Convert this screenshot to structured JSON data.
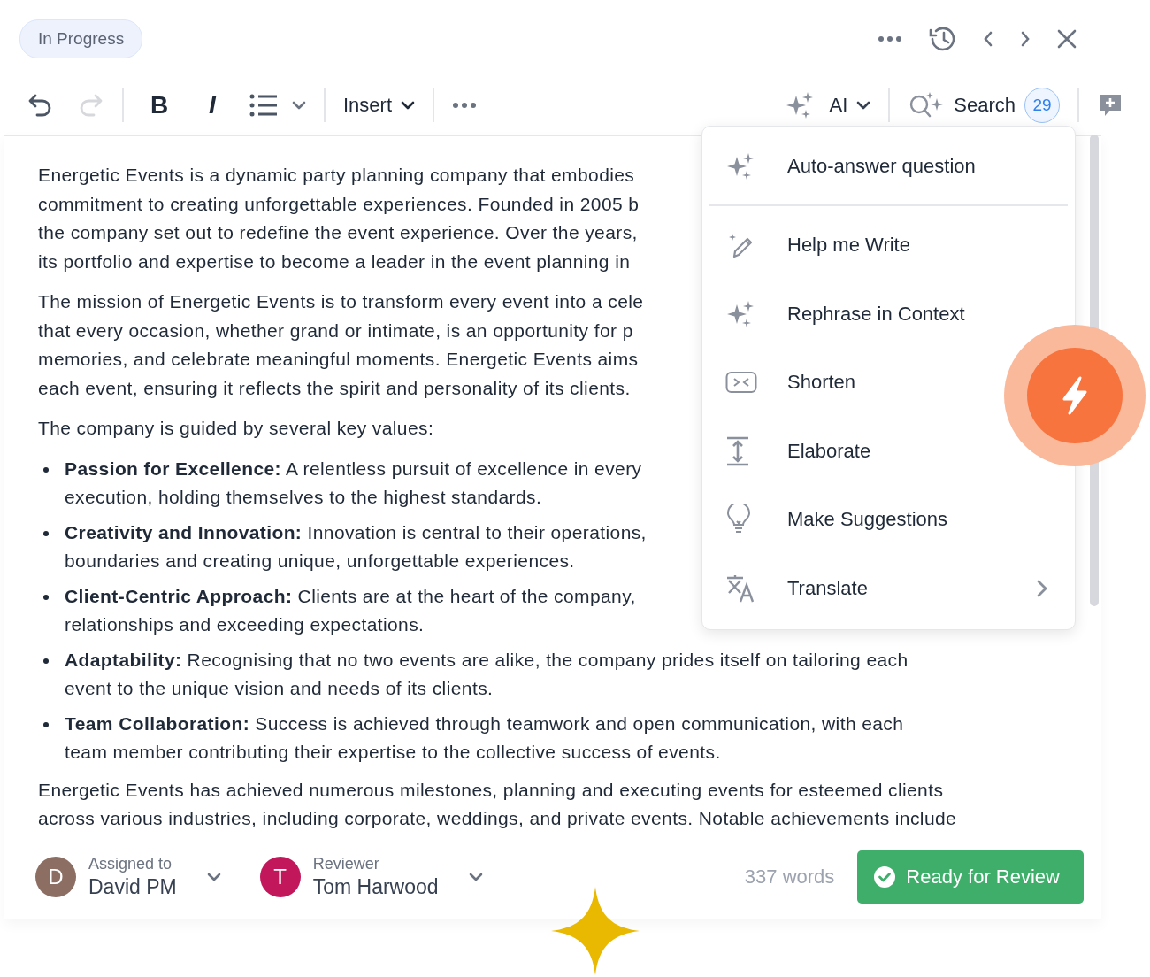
{
  "status_badge": {
    "label": "In Progress"
  },
  "toolbar": {
    "undo": {
      "disabled": false
    },
    "redo": {
      "disabled": true
    },
    "bold_label": "B",
    "italic_label": "I",
    "insert_label": "Insert",
    "ai_label": "AI",
    "search_label": "Search",
    "search_count": "29"
  },
  "ai_menu": {
    "items": [
      {
        "label": "Auto-answer question",
        "divider_after": true,
        "has_submenu": false
      },
      {
        "label": "Help me Write",
        "divider_after": false,
        "has_submenu": false
      },
      {
        "label": "Rephrase in Context",
        "divider_after": false,
        "has_submenu": false
      },
      {
        "label": "Shorten",
        "divider_after": false,
        "has_submenu": false
      },
      {
        "label": "Elaborate",
        "divider_after": false,
        "has_submenu": false
      },
      {
        "label": "Make Suggestions",
        "divider_after": false,
        "has_submenu": false
      },
      {
        "label": "Translate",
        "divider_after": false,
        "has_submenu": true
      }
    ]
  },
  "document": {
    "blocks": [
      {
        "kind": "paragraph",
        "lines": [
          "Energetic Events is a dynamic party planning company that embodies",
          "commitment to creating unforgettable experiences. Founded in 2005 b",
          "the company set out to redefine the event experience. Over the years,",
          "its portfolio and expertise to become a leader in the event planning in"
        ]
      },
      {
        "kind": "paragraph",
        "lines": [
          "The mission of Energetic Events is to transform every event into a cele",
          "that every occasion, whether grand or intimate, is an opportunity for p",
          "memories, and celebrate meaningful moments. Energetic Events aims",
          "each event, ensuring it reflects the spirit and personality of its clients."
        ]
      },
      {
        "kind": "paragraph",
        "lines": [
          "The company is guided by several key values:"
        ]
      },
      {
        "kind": "bullets",
        "items": [
          {
            "lines": [
              "**Passion for Excellence:** A relentless pursuit of excellence in every",
              "execution, holding themselves to the highest standards."
            ]
          },
          {
            "lines": [
              "**Creativity and Innovation:** Innovation is central to their operations,",
              "boundaries and creating unique, unforgettable experiences."
            ]
          },
          {
            "lines": [
              "**Client-Centric Approach:** Clients are at the heart of the company,",
              "relationships and exceeding expectations."
            ]
          },
          {
            "lines": [
              "**Adaptability:** Recognising that no two events are alike, the company prides itself on tailoring each",
              "event to the unique vision and needs of its clients."
            ]
          },
          {
            "lines": [
              "**Team Collaboration:** Success is achieved through teamwork and open communication, with each",
              "team member contributing their expertise to the collective success of events."
            ]
          }
        ]
      },
      {
        "kind": "paragraph",
        "lines": [
          "Energetic Events has achieved numerous milestones, planning and executing events for esteemed clients",
          "across various industries, including corporate, weddings, and private events. Notable achievements include"
        ]
      }
    ]
  },
  "footer": {
    "people": [
      {
        "role": "Assigned to",
        "name": "David PM",
        "initial": "D",
        "color": "#8d6e63"
      },
      {
        "role": "Reviewer",
        "name": "Tom Harwood",
        "initial": "T",
        "color": "#c2185b"
      }
    ],
    "word_count": "337 words",
    "ready_button": "Ready for Review"
  }
}
